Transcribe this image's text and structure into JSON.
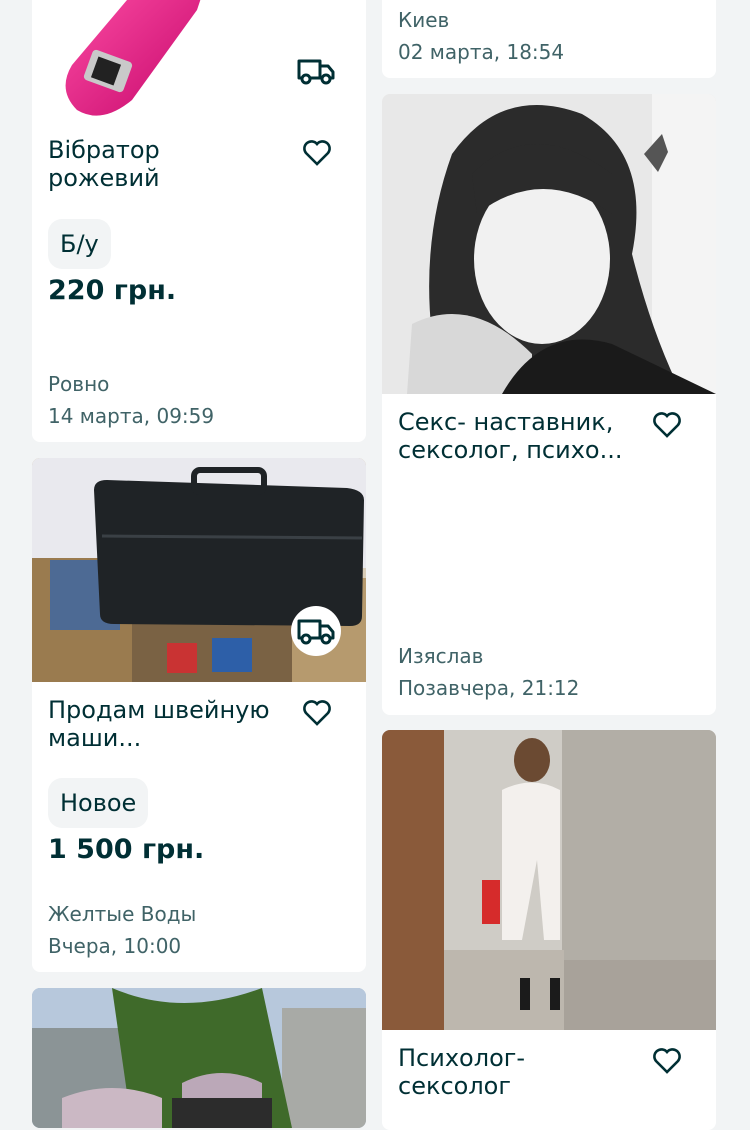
{
  "colors": {
    "background": "#f2f4f5",
    "card": "#ffffff",
    "text_primary": "#002f34",
    "text_secondary": "#406367",
    "product_pink": "#e8157b"
  },
  "icons": {
    "favorite": "heart-outline-icon",
    "delivery": "truck-icon"
  },
  "listings": [
    {
      "title": "Вібратор рожевий",
      "condition": "Б/у",
      "price": "220 грн.",
      "location": "Ровно",
      "date": "14 марта, 09:59"
    },
    {
      "location": "Киев",
      "date": "02 марта, 18:54"
    },
    {
      "title": "Секс- наставник, сексолог, психо...",
      "location": "Изяслав",
      "date": "Позавчера, 21:12"
    },
    {
      "title": "Продам швейную маши...",
      "condition": "Новое",
      "price": "1 500 грн.",
      "location": "Желтые Воды",
      "date": "Вчера, 10:00"
    },
    {
      "title": "Психолог- сексолог"
    }
  ]
}
